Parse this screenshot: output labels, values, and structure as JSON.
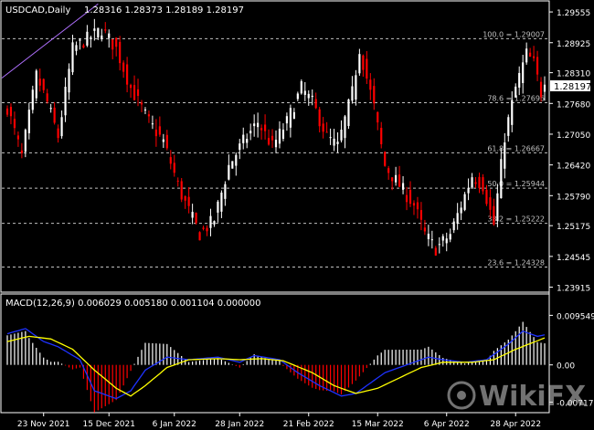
{
  "header": {
    "symbol": "USDCAD,Daily",
    "ohlc": "1.28316 1.28373 1.28189 1.28197"
  },
  "price_axis": {
    "ticks": [
      "1.29555",
      "1.28925",
      "1.28310",
      "1.27680",
      "1.27050",
      "1.26420",
      "1.25790",
      "1.25175",
      "1.24545",
      "1.23915"
    ],
    "current_price": "1.28197"
  },
  "fib_levels": [
    {
      "label": "100.0 = 1.29007",
      "value": 1.29007
    },
    {
      "label": "78.6 = 1.27696",
      "value": 1.27696
    },
    {
      "label": "61.8 = 1.26667",
      "value": 1.26667
    },
    {
      "label": "50.0 = 1.25944",
      "value": 1.25944
    },
    {
      "label": "38.2 = 1.25222",
      "value": 1.25222
    },
    {
      "label": "23.6 = 1.24328",
      "value": 1.24328
    }
  ],
  "macd": {
    "title": "MACD(12,26,9) 0.006029 0.005180 0.001104 0.000000",
    "ticks": [
      "0.009549",
      "0.00",
      "-0.007178"
    ]
  },
  "time_axis": {
    "labels": [
      "23 Nov 2021",
      "15 Dec 2021",
      "6 Jan 2022",
      "28 Jan 2022",
      "21 Feb 2022",
      "15 Mar 2022",
      "6 Apr 2022",
      "28 Apr 2022"
    ]
  },
  "watermark": {
    "text": "WikiFX"
  },
  "colors": {
    "background": "#000000",
    "bull": "#ffffff",
    "bear": "#ff0000",
    "grid": "#c0c0c0",
    "signal": "#ffff00",
    "macd_line": "#1e32ff",
    "trend": "#b070ff",
    "axis": "#ffffff"
  },
  "chart_data": {
    "type": "candlestick",
    "y_range": [
      1.2385,
      1.2965
    ],
    "macd_range": [
      -0.0085,
      0.0105
    ],
    "anchors": [
      {
        "i": 0,
        "p": 1.276
      },
      {
        "i": 4,
        "p": 1.266
      },
      {
        "i": 8,
        "p": 1.2825
      },
      {
        "i": 11,
        "p": 1.277
      },
      {
        "i": 14,
        "p": 1.27
      },
      {
        "i": 18,
        "p": 1.288
      },
      {
        "i": 22,
        "p": 1.29
      },
      {
        "i": 26,
        "p": 1.292
      },
      {
        "i": 30,
        "p": 1.288
      },
      {
        "i": 34,
        "p": 1.28
      },
      {
        "i": 39,
        "p": 1.273
      },
      {
        "i": 43,
        "p": 1.269
      },
      {
        "i": 48,
        "p": 1.258
      },
      {
        "i": 53,
        "p": 1.25
      },
      {
        "i": 57,
        "p": 1.253
      },
      {
        "i": 61,
        "p": 1.264
      },
      {
        "i": 65,
        "p": 1.269
      },
      {
        "i": 69,
        "p": 1.273
      },
      {
        "i": 73,
        "p": 1.268
      },
      {
        "i": 77,
        "p": 1.273
      },
      {
        "i": 81,
        "p": 1.28
      },
      {
        "i": 84,
        "p": 1.277
      },
      {
        "i": 88,
        "p": 1.27
      },
      {
        "i": 91,
        "p": 1.268
      },
      {
        "i": 95,
        "p": 1.279
      },
      {
        "i": 97,
        "p": 1.288
      },
      {
        "i": 101,
        "p": 1.276
      },
      {
        "i": 104,
        "p": 1.264
      },
      {
        "i": 108,
        "p": 1.26
      },
      {
        "i": 112,
        "p": 1.256
      },
      {
        "i": 115,
        "p": 1.25
      },
      {
        "i": 118,
        "p": 1.247
      },
      {
        "i": 122,
        "p": 1.25
      },
      {
        "i": 125,
        "p": 1.256
      },
      {
        "i": 128,
        "p": 1.262
      },
      {
        "i": 131,
        "p": 1.26
      },
      {
        "i": 134,
        "p": 1.252
      },
      {
        "i": 137,
        "p": 1.27
      },
      {
        "i": 140,
        "p": 1.28
      },
      {
        "i": 143,
        "p": 1.287
      },
      {
        "i": 145,
        "p": 1.285
      },
      {
        "i": 147,
        "p": 1.279
      },
      {
        "i": 148,
        "p": 1.282
      }
    ],
    "macd_line_anchors": [
      {
        "i": 0,
        "v": 0.006
      },
      {
        "i": 5,
        "v": 0.007
      },
      {
        "i": 10,
        "v": 0.0045
      },
      {
        "i": 14,
        "v": 0.0035
      },
      {
        "i": 20,
        "v": 0.001
      },
      {
        "i": 24,
        "v": -0.005
      },
      {
        "i": 30,
        "v": -0.0065
      },
      {
        "i": 34,
        "v": -0.005
      },
      {
        "i": 38,
        "v": -0.001
      },
      {
        "i": 44,
        "v": 0.0015
      },
      {
        "i": 50,
        "v": 0.001
      },
      {
        "i": 58,
        "v": 0.0015
      },
      {
        "i": 64,
        "v": 0.0005
      },
      {
        "i": 68,
        "v": 0.0018
      },
      {
        "i": 75,
        "v": 0.001
      },
      {
        "i": 80,
        "v": -0.0015
      },
      {
        "i": 86,
        "v": -0.004
      },
      {
        "i": 92,
        "v": -0.006
      },
      {
        "i": 96,
        "v": -0.0055
      },
      {
        "i": 100,
        "v": -0.0035
      },
      {
        "i": 104,
        "v": -0.0015
      },
      {
        "i": 110,
        "v": 0.0
      },
      {
        "i": 116,
        "v": 0.0015
      },
      {
        "i": 120,
        "v": 0.001
      },
      {
        "i": 126,
        "v": 0.0005
      },
      {
        "i": 132,
        "v": 0.001
      },
      {
        "i": 138,
        "v": 0.004
      },
      {
        "i": 142,
        "v": 0.0065
      },
      {
        "i": 146,
        "v": 0.0055
      },
      {
        "i": 148,
        "v": 0.0058
      }
    ],
    "signal_anchors": [
      {
        "i": 0,
        "v": 0.0045
      },
      {
        "i": 6,
        "v": 0.0055
      },
      {
        "i": 12,
        "v": 0.005
      },
      {
        "i": 18,
        "v": 0.003
      },
      {
        "i": 24,
        "v": -0.001
      },
      {
        "i": 30,
        "v": -0.0045
      },
      {
        "i": 34,
        "v": -0.006
      },
      {
        "i": 38,
        "v": -0.004
      },
      {
        "i": 44,
        "v": -0.0005
      },
      {
        "i": 50,
        "v": 0.001
      },
      {
        "i": 58,
        "v": 0.0012
      },
      {
        "i": 64,
        "v": 0.001
      },
      {
        "i": 70,
        "v": 0.0012
      },
      {
        "i": 76,
        "v": 0.0008
      },
      {
        "i": 84,
        "v": -0.0015
      },
      {
        "i": 90,
        "v": -0.004
      },
      {
        "i": 96,
        "v": -0.0055
      },
      {
        "i": 102,
        "v": -0.0045
      },
      {
        "i": 108,
        "v": -0.0025
      },
      {
        "i": 114,
        "v": -0.0005
      },
      {
        "i": 120,
        "v": 0.0005
      },
      {
        "i": 128,
        "v": 0.0005
      },
      {
        "i": 134,
        "v": 0.001
      },
      {
        "i": 140,
        "v": 0.003
      },
      {
        "i": 148,
        "v": 0.0052
      }
    ]
  }
}
